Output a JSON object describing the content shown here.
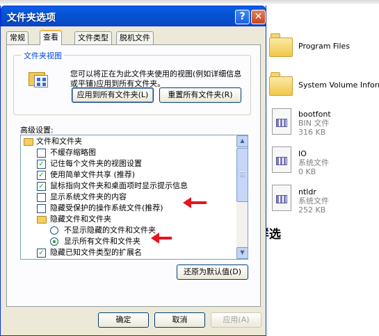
{
  "explorer": {
    "files": [
      {
        "name": "Program Files",
        "type": "",
        "size": "",
        "icon": "folder-icon"
      },
      {
        "name": "System Volume Informat",
        "type": "",
        "size": "",
        "icon": "folder-icon"
      },
      {
        "name": "bootfont",
        "type": "BIN 文件",
        "size": "316 KB",
        "icon": "system-file-icon"
      },
      {
        "name": "IO",
        "type": "系统文件",
        "size": "0 KB",
        "icon": "system-file-icon"
      },
      {
        "name": "ntldr",
        "type": "系统文件",
        "size": "252 KB",
        "icon": "system-file-icon"
      }
    ]
  },
  "annotation": "象这样选",
  "dialog": {
    "title": "文件夹选项",
    "help_glyph": "?",
    "close_glyph": "✕",
    "tabs": [
      "常规",
      "查看",
      "文件类型",
      "脱机文件"
    ],
    "active_tab": "查看",
    "folder_views": {
      "title": "文件夹视图",
      "description": "您可以将正在为此文件夹使用的视图(例如详细信息或平铺)应用到所有文件夹。",
      "apply_all": "应用到所有文件夹(L)",
      "reset_all": "重置所有文件夹(R)"
    },
    "advanced": {
      "label": "高级设置:",
      "items": [
        {
          "kind": "folder",
          "label": "文件和文件夹",
          "checked": null
        },
        {
          "kind": "checkbox",
          "label": "不缓存缩略图",
          "checked": false
        },
        {
          "kind": "checkbox",
          "label": "记住每个文件夹的视图设置",
          "checked": true
        },
        {
          "kind": "checkbox",
          "label": "使用简单文件共享 (推荐)",
          "checked": true
        },
        {
          "kind": "checkbox",
          "label": "鼠标指向文件夹和桌面项时显示提示信息",
          "checked": true
        },
        {
          "kind": "checkbox",
          "label": "显示系统文件夹的内容",
          "checked": false
        },
        {
          "kind": "checkbox",
          "label": "隐藏受保护的操作系统文件(推荐)",
          "checked": false
        },
        {
          "kind": "folder",
          "label": "隐藏文件和文件夹",
          "checked": null
        },
        {
          "kind": "radio",
          "label": "不显示隐藏的文件和文件夹",
          "checked": false
        },
        {
          "kind": "radio",
          "label": "显示所有文件和文件夹",
          "checked": true
        },
        {
          "kind": "checkbox",
          "label": "隐藏已知文件类型的扩展名",
          "checked": true
        }
      ],
      "restore_defaults": "还原为默认值(D)"
    },
    "buttons": {
      "ok": "确定",
      "cancel": "取消",
      "apply": "应用(A)"
    },
    "colors": {
      "titlebar": "#0553d3",
      "tab_highlight": "#f8b34a",
      "arrow": "#e8141e",
      "check": "#21a121"
    }
  }
}
